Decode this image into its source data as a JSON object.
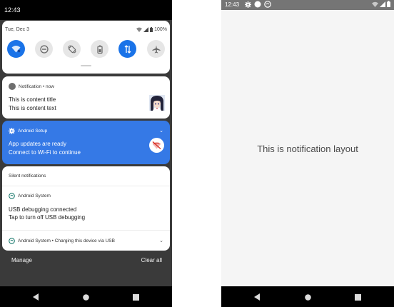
{
  "left_phone": {
    "status_bar": {
      "time": "12:43"
    },
    "quick_settings": {
      "date": "Tue, Dec 3",
      "battery_percent": "100%",
      "tiles": [
        {
          "icon": "wifi-icon",
          "active": true
        },
        {
          "icon": "do-not-disturb-icon",
          "active": false
        },
        {
          "icon": "auto-rotate-icon",
          "active": false
        },
        {
          "icon": "battery-saver-icon",
          "active": false
        },
        {
          "icon": "mobile-data-icon",
          "active": true
        },
        {
          "icon": "airplane-mode-icon",
          "active": false
        }
      ]
    },
    "notification_card": {
      "app": "Notification",
      "time": "now",
      "header": "Notification • now",
      "title": "This is content title",
      "text": "This is content text"
    },
    "setup_card": {
      "app": "Android Setup",
      "title": "App updates are ready",
      "text": "Connect to Wi-Fi to continue"
    },
    "silent_section": {
      "label": "Silent notifications",
      "system_app": "Android System",
      "title": "USB debugging connected",
      "text": "Tap to turn off USB debugging",
      "collapsed_row": "Android System • Charging this device via USB"
    },
    "footer": {
      "manage_label": "Manage",
      "clear_all_label": "Clear all"
    }
  },
  "right_phone": {
    "status_bar": {
      "time": "12:43"
    },
    "content_text": "This is notification layout"
  },
  "colors": {
    "accent_blue": "#1a73e8",
    "setup_card_blue": "#3579e6",
    "shade_background": "#3a3a3a",
    "status_bar_gray": "#757575"
  }
}
